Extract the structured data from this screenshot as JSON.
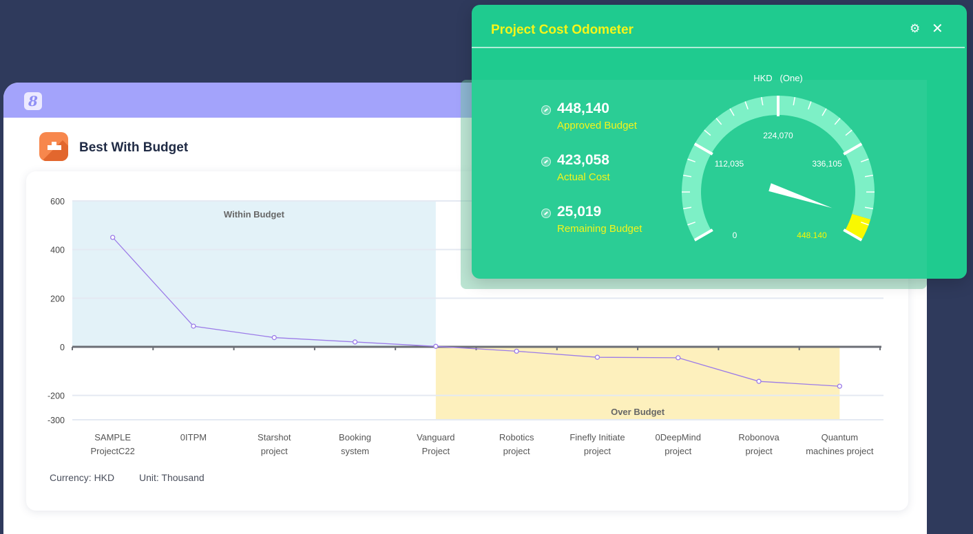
{
  "main": {
    "brand_glyph": "8",
    "section_title": "Best With Budget",
    "footer": {
      "currency": "Currency: HKD",
      "unit": "Unit: Thousand"
    }
  },
  "chart_data": {
    "type": "line",
    "categories": [
      [
        "SAMPLE",
        "ProjectC22"
      ],
      [
        "0ITPM"
      ],
      [
        "Starshot",
        "project"
      ],
      [
        "Booking",
        "system"
      ],
      [
        "Vanguard",
        "Project"
      ],
      [
        "Robotics",
        "project"
      ],
      [
        "Finefly Initiate",
        "project"
      ],
      [
        "0DeepMind",
        "project"
      ],
      [
        "Robonova",
        "project"
      ],
      [
        "Quantum",
        "machines project"
      ]
    ],
    "series": [
      {
        "values": [
          450,
          85,
          38,
          20,
          2,
          -18,
          -43,
          -45,
          -142,
          -162
        ]
      }
    ],
    "y_ticks": [
      600,
      400,
      200,
      0,
      -200,
      -300
    ],
    "ylim": [
      -300,
      600
    ],
    "regions": [
      {
        "label": "Within Budget",
        "from_category": 0,
        "to_category": 4,
        "sign": "positive",
        "color": "#e3f2f8"
      },
      {
        "label": "Over Budget",
        "from_category": 4,
        "to_category": 9,
        "sign": "negative",
        "color": "#fdf0bd"
      }
    ],
    "line_color": "#9b7be8",
    "grid": true
  },
  "odometer": {
    "title": "Project Cost Odometer",
    "unit_label": "HKD   (One)",
    "stats": [
      {
        "value": "448,140",
        "label": "Approved Budget"
      },
      {
        "value": "423,058",
        "label": "Actual Cost"
      },
      {
        "value": "25,019",
        "label": "Remaining Budget"
      }
    ],
    "gauge": {
      "min": 0,
      "max": 448140,
      "current": 423058,
      "scale_labels": [
        "0",
        "112,035",
        "224,070",
        "336,105",
        "448,140"
      ],
      "end_label": "448.140",
      "arc_color": "#7df0c6",
      "warn_color": "#f9f900",
      "needle_color": "#ffffff"
    },
    "colors": {
      "background": "#1fcb8f",
      "accent": "#f5f51a"
    }
  }
}
